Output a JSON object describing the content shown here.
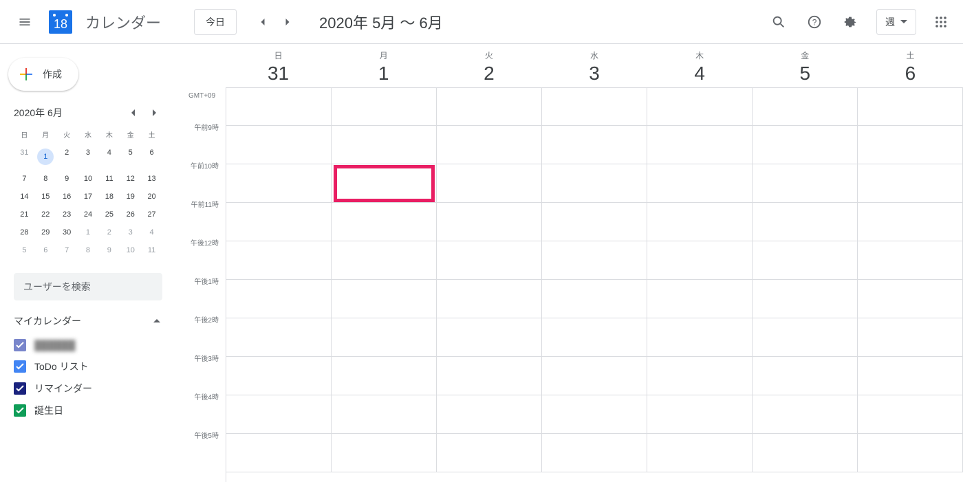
{
  "header": {
    "logo_day": "18",
    "app_title": "カレンダー",
    "today_label": "今日",
    "date_range": "2020年 5月 ～ 6月",
    "view_label": "週"
  },
  "sidebar": {
    "create_label": "作成",
    "mini_title": "2020年 6月",
    "dow": [
      "日",
      "月",
      "火",
      "水",
      "木",
      "金",
      "土"
    ],
    "weeks": [
      [
        {
          "d": "31",
          "o": true
        },
        {
          "d": "1",
          "sel": true
        },
        {
          "d": "2"
        },
        {
          "d": "3"
        },
        {
          "d": "4"
        },
        {
          "d": "5"
        },
        {
          "d": "6"
        }
      ],
      [
        {
          "d": "7"
        },
        {
          "d": "8"
        },
        {
          "d": "9"
        },
        {
          "d": "10"
        },
        {
          "d": "11"
        },
        {
          "d": "12"
        },
        {
          "d": "13"
        }
      ],
      [
        {
          "d": "14"
        },
        {
          "d": "15"
        },
        {
          "d": "16"
        },
        {
          "d": "17"
        },
        {
          "d": "18"
        },
        {
          "d": "19"
        },
        {
          "d": "20"
        }
      ],
      [
        {
          "d": "21"
        },
        {
          "d": "22"
        },
        {
          "d": "23"
        },
        {
          "d": "24"
        },
        {
          "d": "25"
        },
        {
          "d": "26"
        },
        {
          "d": "27"
        }
      ],
      [
        {
          "d": "28"
        },
        {
          "d": "29"
        },
        {
          "d": "30"
        },
        {
          "d": "1",
          "o": true
        },
        {
          "d": "2",
          "o": true
        },
        {
          "d": "3",
          "o": true
        },
        {
          "d": "4",
          "o": true
        }
      ],
      [
        {
          "d": "5",
          "o": true
        },
        {
          "d": "6",
          "o": true
        },
        {
          "d": "7",
          "o": true
        },
        {
          "d": "8",
          "o": true
        },
        {
          "d": "9",
          "o": true
        },
        {
          "d": "10",
          "o": true
        },
        {
          "d": "11",
          "o": true
        }
      ]
    ],
    "search_placeholder": "ユーザーを検索",
    "section_title": "マイカレンダー",
    "calendars": [
      {
        "label": "██████",
        "color": "#7986cb",
        "blur": true
      },
      {
        "label": "ToDo リスト",
        "color": "#4285f4"
      },
      {
        "label": "リマインダー",
        "color": "#1a237e"
      },
      {
        "label": "誕生日",
        "color": "#0f9d58"
      }
    ]
  },
  "main": {
    "timezone": "GMT+09",
    "days": [
      {
        "dow": "日",
        "num": "31"
      },
      {
        "dow": "月",
        "num": "1"
      },
      {
        "dow": "火",
        "num": "2"
      },
      {
        "dow": "水",
        "num": "3"
      },
      {
        "dow": "木",
        "num": "4"
      },
      {
        "dow": "金",
        "num": "5"
      },
      {
        "dow": "土",
        "num": "6"
      }
    ],
    "hours": [
      "",
      "午前9時",
      "午前10時",
      "午前11時",
      "午後12時",
      "午後1時",
      "午後2時",
      "午後3時",
      "午後4時",
      "午後5時"
    ],
    "highlight": {
      "day_index": 1,
      "hour_index": 2
    }
  }
}
